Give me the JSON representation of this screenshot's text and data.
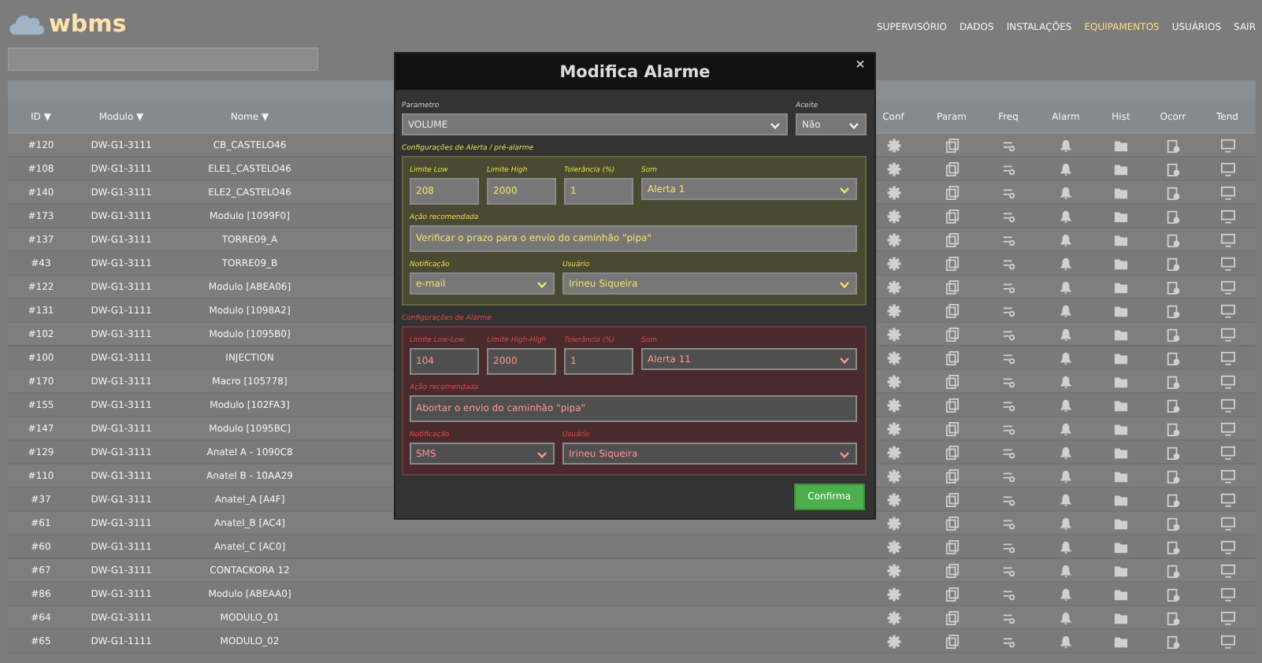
{
  "header": {
    "logo": "wbms",
    "nav": [
      {
        "label": "SUPERVISÓRIO",
        "selected": false
      },
      {
        "label": "DADOS",
        "selected": false
      },
      {
        "label": "INSTALAÇÕES",
        "selected": false
      },
      {
        "label": "EQUIPAMENTOS",
        "selected": true
      },
      {
        "label": "USUÁRIOS",
        "selected": false
      },
      {
        "label": "SAIR",
        "selected": false
      }
    ]
  },
  "table": {
    "columns": [
      {
        "label": "ID ▼",
        "kind": "text"
      },
      {
        "label": "Modulo ▼",
        "kind": "text"
      },
      {
        "label": "Nome ▼",
        "kind": "text"
      },
      {
        "label": "Conf",
        "kind": "gear"
      },
      {
        "label": "Param",
        "kind": "doc"
      },
      {
        "label": "Freq",
        "kind": "list"
      },
      {
        "label": "Alarm",
        "kind": "bell"
      },
      {
        "label": "Hist",
        "kind": "folder"
      },
      {
        "label": "Ocorr",
        "kind": "clip"
      },
      {
        "label": "Tend",
        "kind": "monitor"
      }
    ],
    "rows": [
      {
        "id": "#120",
        "module": "DW-G1-3111",
        "name": "CB_CASTELO46"
      },
      {
        "id": "#108",
        "module": "DW-G1-3111",
        "name": "ELE1_CASTELO46"
      },
      {
        "id": "#140",
        "module": "DW-G1-3111",
        "name": "ELE2_CASTELO46"
      },
      {
        "id": "#173",
        "module": "DW-G1-3111",
        "name": "Modulo [1099F0]"
      },
      {
        "id": "#137",
        "module": "DW-G1-3111",
        "name": "TORRE09_A"
      },
      {
        "id": "#43",
        "module": "DW-G1-3111",
        "name": "TORRE09_B"
      },
      {
        "id": "#122",
        "module": "DW-G1-3111",
        "name": "Modulo [ABEA06]"
      },
      {
        "id": "#131",
        "module": "DW-G1-1111",
        "name": "Modulo [1098A2]"
      },
      {
        "id": "#102",
        "module": "DW-G1-3111",
        "name": "Modulo [1095B0]"
      },
      {
        "id": "#100",
        "module": "DW-G1-3111",
        "name": "INJECTION"
      },
      {
        "id": "#170",
        "module": "DW-G1-3111",
        "name": "Macro [105778]"
      },
      {
        "id": "#155",
        "module": "DW-G1-3111",
        "name": "Modulo [102FA3]"
      },
      {
        "id": "#147",
        "module": "DW-G1-3111",
        "name": "Modulo [1095BC]"
      },
      {
        "id": "#129",
        "module": "DW-G1-3111",
        "name": "Anatel A - 1090C8"
      },
      {
        "id": "#110",
        "module": "DW-G1-3111",
        "name": "Anatel B - 10AA29"
      },
      {
        "id": "#37",
        "module": "DW-G1-3111",
        "name": "Anatel_A [A4F]"
      },
      {
        "id": "#61",
        "module": "DW-G1-3111",
        "name": "Anatel_B [AC4]"
      },
      {
        "id": "#60",
        "module": "DW-G1-3111",
        "name": "Anatel_C [AC0]"
      },
      {
        "id": "#67",
        "module": "DW-G1-3111",
        "name": "CONTACKORA 12"
      },
      {
        "id": "#86",
        "module": "DW-G1-3111",
        "name": "Modulo [ABEAA0]"
      },
      {
        "id": "#64",
        "module": "DW-G1-3111",
        "name": "MODULO_01"
      },
      {
        "id": "#65",
        "module": "DW-G1-1111",
        "name": "MODULO_02"
      }
    ]
  },
  "modal": {
    "title": "Modifica Alarme",
    "close": "×",
    "parameter": {
      "label": "Parametro",
      "value": "VOLUME"
    },
    "accept": {
      "label": "Aceite",
      "value": "Não"
    },
    "sections": [
      {
        "kind": "alert",
        "title": "Configurações de Alerta / pré-alarme",
        "limits": [
          {
            "label": "Limite Low",
            "value": "208",
            "kind": "input"
          },
          {
            "label": "Limite High",
            "value": "2000",
            "kind": "input"
          },
          {
            "label": "Tolerância (%)",
            "value": "1",
            "kind": "input"
          },
          {
            "label": "Som",
            "value": "Alerta 1",
            "kind": "select"
          }
        ],
        "action": {
          "label": "Ação recomendada",
          "value": "Verificar o prazo para o envio do caminhão \"pipa\""
        },
        "notify": [
          {
            "label": "Notificação",
            "value": "e-mail",
            "kind": "select"
          },
          {
            "label": "Usuário",
            "value": "Irineu Siqueira",
            "kind": "select"
          }
        ]
      },
      {
        "kind": "alarm",
        "title": "Configurações de Alarme",
        "limits": [
          {
            "label": "Limite Low-Low",
            "value": "104",
            "kind": "input"
          },
          {
            "label": "Limite High-High",
            "value": "2000",
            "kind": "input"
          },
          {
            "label": "Tolerância (%)",
            "value": "1",
            "kind": "input"
          },
          {
            "label": "Som",
            "value": "Alerta 11",
            "kind": "select"
          }
        ],
        "action": {
          "label": "Ação recomendada",
          "value": "Abortar o envio do caminhão \"pipa\""
        },
        "notify": [
          {
            "label": "Notificação",
            "value": "SMS",
            "kind": "select"
          },
          {
            "label": "Usuário",
            "value": "Irineu Siqueira",
            "kind": "select"
          }
        ]
      }
    ],
    "confirm": "Confirma"
  }
}
